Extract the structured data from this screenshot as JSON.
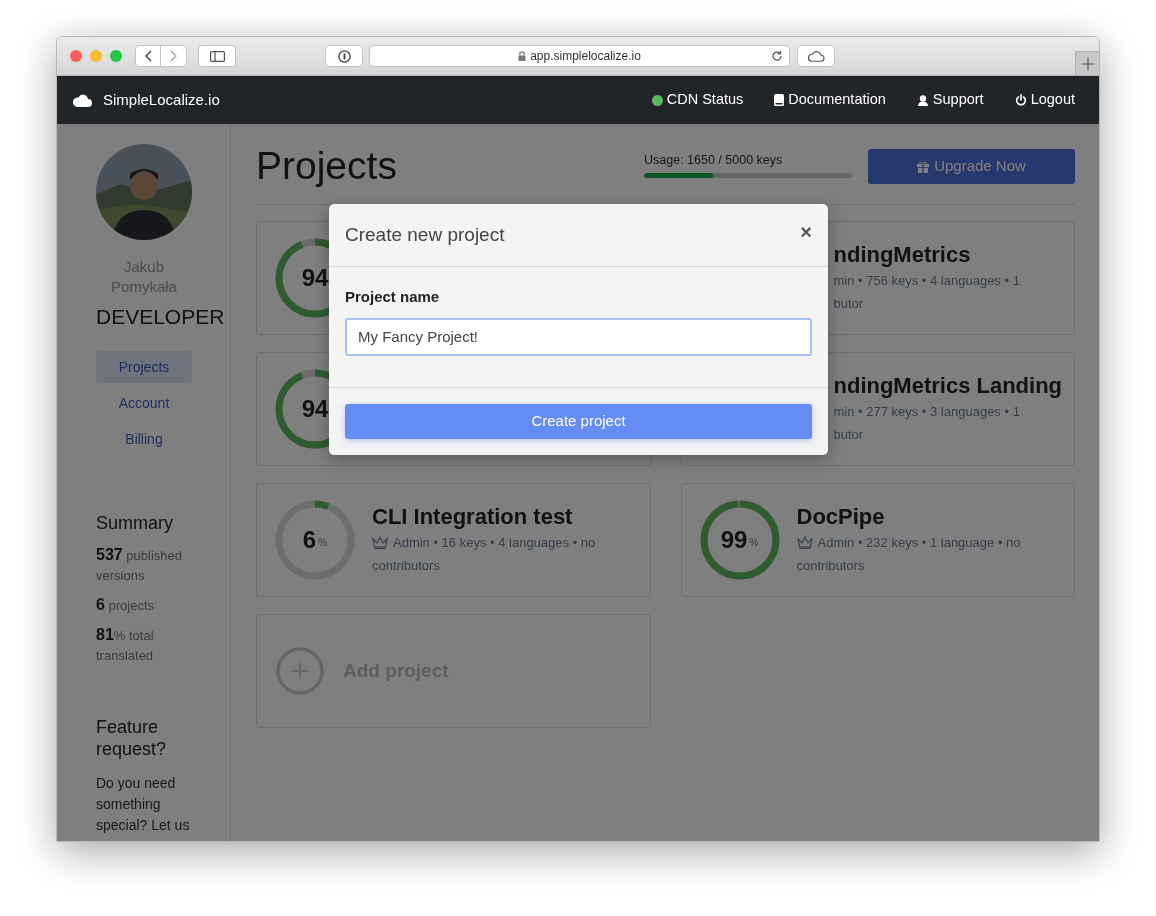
{
  "browser": {
    "url": "app.simplelocalize.io"
  },
  "navbar": {
    "brand": "SimpleLocalize.io",
    "links": [
      {
        "kind": "status",
        "label": "CDN Status",
        "color": "#5cb85c"
      },
      {
        "kind": "docs",
        "label": "Documentation"
      },
      {
        "kind": "support",
        "label": "Support"
      },
      {
        "kind": "logout",
        "label": "Logout"
      }
    ]
  },
  "sidebar": {
    "user": {
      "name": "Jakub Pomykała",
      "plan": "DEVELOPER"
    },
    "menu": [
      {
        "label": "Projects",
        "selected": true
      },
      {
        "label": "Account",
        "selected": false
      },
      {
        "label": "Billing",
        "selected": false
      }
    ],
    "summary": {
      "title": "Summary",
      "stats": [
        {
          "value": "537",
          "label": "published versions"
        },
        {
          "value": "6",
          "label": "projects"
        },
        {
          "value": "81",
          "unit": "%",
          "label": "total translated"
        }
      ]
    },
    "feature": {
      "title": "Feature request?",
      "text": "Do you need something special? Let us"
    }
  },
  "main": {
    "title": "Projects",
    "usage": {
      "label": "Usage: 1650 / 5000 keys",
      "level": 0.33
    },
    "upgrade_button": "Upgrade Now",
    "projects": [
      {
        "percent": "94"
      },
      {
        "title": "ndingMetrics",
        "meta_lines": [
          "min • 756 keys • 4 languages • 1",
          "butor"
        ],
        "crown": false
      },
      {
        "percent": "94"
      },
      {
        "title": "ndingMetrics Landing",
        "meta_lines": [
          "min • 277 keys • 3 languages • 1",
          "butor"
        ],
        "crown": false
      },
      {
        "percent": "6",
        "unit": "%",
        "level": 0.06,
        "title": "CLI Integration test",
        "meta_lines": [
          "Admin • 16 keys • 4 languages • no",
          "contributors"
        ],
        "crown": true
      },
      {
        "percent": "99",
        "unit": "%",
        "level": 0.99,
        "title": "DocPipe",
        "meta_lines": [
          "Admin • 232 keys • 1 language • no",
          "contributors"
        ],
        "crown": true
      }
    ],
    "add_project": "Add project"
  },
  "modal": {
    "title": "Create new project",
    "close": "×",
    "field_label": "Project name",
    "value": "My Fancy Project!",
    "submit": "Create project"
  }
}
